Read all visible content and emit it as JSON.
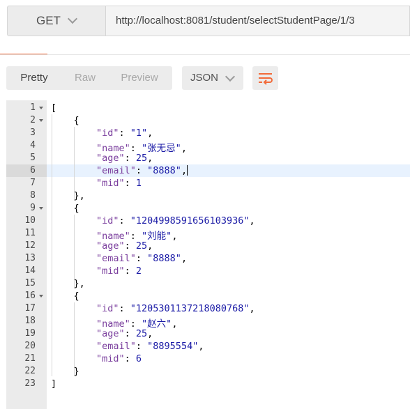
{
  "request": {
    "method": "GET",
    "url": "http://localhost:8081/student/selectStudentPage/1/3"
  },
  "response": {
    "view_tabs": [
      "Pretty",
      "Raw",
      "Preview"
    ],
    "active_view": "Pretty",
    "format": "JSON",
    "wrap_icon": "wrap-lines-icon",
    "accent_color": "#f26b3a"
  },
  "lines": [
    {
      "num": "1",
      "indent": 0,
      "tokens": [
        {
          "t": "p",
          "v": "["
        }
      ],
      "fold": true
    },
    {
      "num": "2",
      "indent": 1,
      "tokens": [
        {
          "t": "p",
          "v": "{"
        }
      ],
      "fold": true
    },
    {
      "num": "3",
      "indent": 2,
      "tokens": [
        {
          "t": "k",
          "v": "\"id\""
        },
        {
          "t": "p",
          "v": ": "
        },
        {
          "t": "s",
          "v": "\"1\""
        },
        {
          "t": "p",
          "v": ","
        }
      ]
    },
    {
      "num": "4",
      "indent": 2,
      "tokens": [
        {
          "t": "k",
          "v": "\"name\""
        },
        {
          "t": "p",
          "v": ": "
        },
        {
          "t": "s",
          "v": "\"张无忌\""
        },
        {
          "t": "p",
          "v": ","
        }
      ]
    },
    {
      "num": "5",
      "indent": 2,
      "tokens": [
        {
          "t": "k",
          "v": "\"age\""
        },
        {
          "t": "p",
          "v": ": "
        },
        {
          "t": "n",
          "v": "25"
        },
        {
          "t": "p",
          "v": ","
        }
      ]
    },
    {
      "num": "6",
      "indent": 2,
      "tokens": [
        {
          "t": "k",
          "v": "\"email\""
        },
        {
          "t": "p",
          "v": ": "
        },
        {
          "t": "s",
          "v": "\"8888\""
        },
        {
          "t": "p",
          "v": ","
        }
      ],
      "active": true
    },
    {
      "num": "7",
      "indent": 2,
      "tokens": [
        {
          "t": "k",
          "v": "\"mid\""
        },
        {
          "t": "p",
          "v": ": "
        },
        {
          "t": "n",
          "v": "1"
        }
      ]
    },
    {
      "num": "8",
      "indent": 1,
      "tokens": [
        {
          "t": "p",
          "v": "},"
        }
      ]
    },
    {
      "num": "9",
      "indent": 1,
      "tokens": [
        {
          "t": "p",
          "v": "{"
        }
      ],
      "fold": true
    },
    {
      "num": "10",
      "indent": 2,
      "tokens": [
        {
          "t": "k",
          "v": "\"id\""
        },
        {
          "t": "p",
          "v": ": "
        },
        {
          "t": "s",
          "v": "\"1204998591656103936\""
        },
        {
          "t": "p",
          "v": ","
        }
      ]
    },
    {
      "num": "11",
      "indent": 2,
      "tokens": [
        {
          "t": "k",
          "v": "\"name\""
        },
        {
          "t": "p",
          "v": ": "
        },
        {
          "t": "s",
          "v": "\"刘能\""
        },
        {
          "t": "p",
          "v": ","
        }
      ]
    },
    {
      "num": "12",
      "indent": 2,
      "tokens": [
        {
          "t": "k",
          "v": "\"age\""
        },
        {
          "t": "p",
          "v": ": "
        },
        {
          "t": "n",
          "v": "25"
        },
        {
          "t": "p",
          "v": ","
        }
      ]
    },
    {
      "num": "13",
      "indent": 2,
      "tokens": [
        {
          "t": "k",
          "v": "\"email\""
        },
        {
          "t": "p",
          "v": ": "
        },
        {
          "t": "s",
          "v": "\"8888\""
        },
        {
          "t": "p",
          "v": ","
        }
      ]
    },
    {
      "num": "14",
      "indent": 2,
      "tokens": [
        {
          "t": "k",
          "v": "\"mid\""
        },
        {
          "t": "p",
          "v": ": "
        },
        {
          "t": "n",
          "v": "2"
        }
      ]
    },
    {
      "num": "15",
      "indent": 1,
      "tokens": [
        {
          "t": "p",
          "v": "},"
        }
      ]
    },
    {
      "num": "16",
      "indent": 1,
      "tokens": [
        {
          "t": "p",
          "v": "{"
        }
      ],
      "fold": true
    },
    {
      "num": "17",
      "indent": 2,
      "tokens": [
        {
          "t": "k",
          "v": "\"id\""
        },
        {
          "t": "p",
          "v": ": "
        },
        {
          "t": "s",
          "v": "\"1205301137218080768\""
        },
        {
          "t": "p",
          "v": ","
        }
      ]
    },
    {
      "num": "18",
      "indent": 2,
      "tokens": [
        {
          "t": "k",
          "v": "\"name\""
        },
        {
          "t": "p",
          "v": ": "
        },
        {
          "t": "s",
          "v": "\"赵六\""
        },
        {
          "t": "p",
          "v": ","
        }
      ]
    },
    {
      "num": "19",
      "indent": 2,
      "tokens": [
        {
          "t": "k",
          "v": "\"age\""
        },
        {
          "t": "p",
          "v": ": "
        },
        {
          "t": "n",
          "v": "25"
        },
        {
          "t": "p",
          "v": ","
        }
      ]
    },
    {
      "num": "20",
      "indent": 2,
      "tokens": [
        {
          "t": "k",
          "v": "\"email\""
        },
        {
          "t": "p",
          "v": ": "
        },
        {
          "t": "s",
          "v": "\"8895554\""
        },
        {
          "t": "p",
          "v": ","
        }
      ]
    },
    {
      "num": "21",
      "indent": 2,
      "tokens": [
        {
          "t": "k",
          "v": "\"mid\""
        },
        {
          "t": "p",
          "v": ": "
        },
        {
          "t": "n",
          "v": "6"
        }
      ]
    },
    {
      "num": "22",
      "indent": 1,
      "tokens": [
        {
          "t": "p",
          "v": "}"
        }
      ]
    },
    {
      "num": "23",
      "indent": 0,
      "tokens": [
        {
          "t": "p",
          "v": "]"
        }
      ]
    }
  ]
}
